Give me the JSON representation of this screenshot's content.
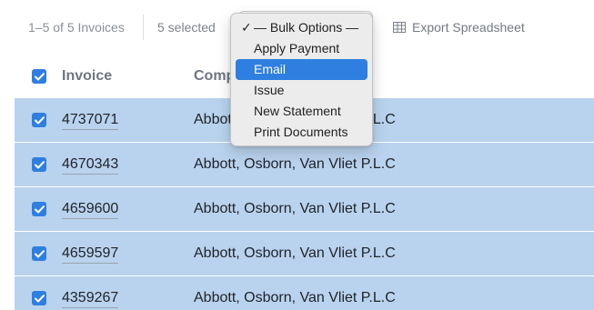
{
  "toolbar": {
    "range_label": "1–5 of 5 Invoices",
    "selected_label": "5 selected",
    "export_label": "Export Spreadsheet",
    "export_icon": "table-grid-icon"
  },
  "table": {
    "headers": {
      "invoice": "Invoice",
      "company": "Comp"
    },
    "rows": [
      {
        "invoice": "4737071",
        "company": "Abbott, Osborn, Van Vliet P.L.C",
        "company_visible": "Abbo",
        "company_tail": "L.C",
        "selected": true
      },
      {
        "invoice": "4670343",
        "company": "Abbott, Osborn, Van Vliet P.L.C",
        "selected": true
      },
      {
        "invoice": "4659600",
        "company": "Abbott, Osborn, Van Vliet P.L.C",
        "selected": true
      },
      {
        "invoice": "4659597",
        "company": "Abbott, Osborn, Van Vliet P.L.C",
        "selected": true
      },
      {
        "invoice": "4359267",
        "company": "Abbott, Osborn, Van Vliet P.L.C",
        "selected": true
      }
    ]
  },
  "bulk_menu": {
    "items": [
      {
        "label": "— Bulk Options —",
        "checked": true
      },
      {
        "label": "Apply Payment"
      },
      {
        "label": "Email",
        "highlighted": true
      },
      {
        "label": "Issue"
      },
      {
        "label": "New Statement"
      },
      {
        "label": "Print Documents"
      }
    ]
  },
  "colors": {
    "accent": "#2f7fe0",
    "selected_row_bg": "#b9d3ee",
    "muted_text": "#8a8f98"
  }
}
